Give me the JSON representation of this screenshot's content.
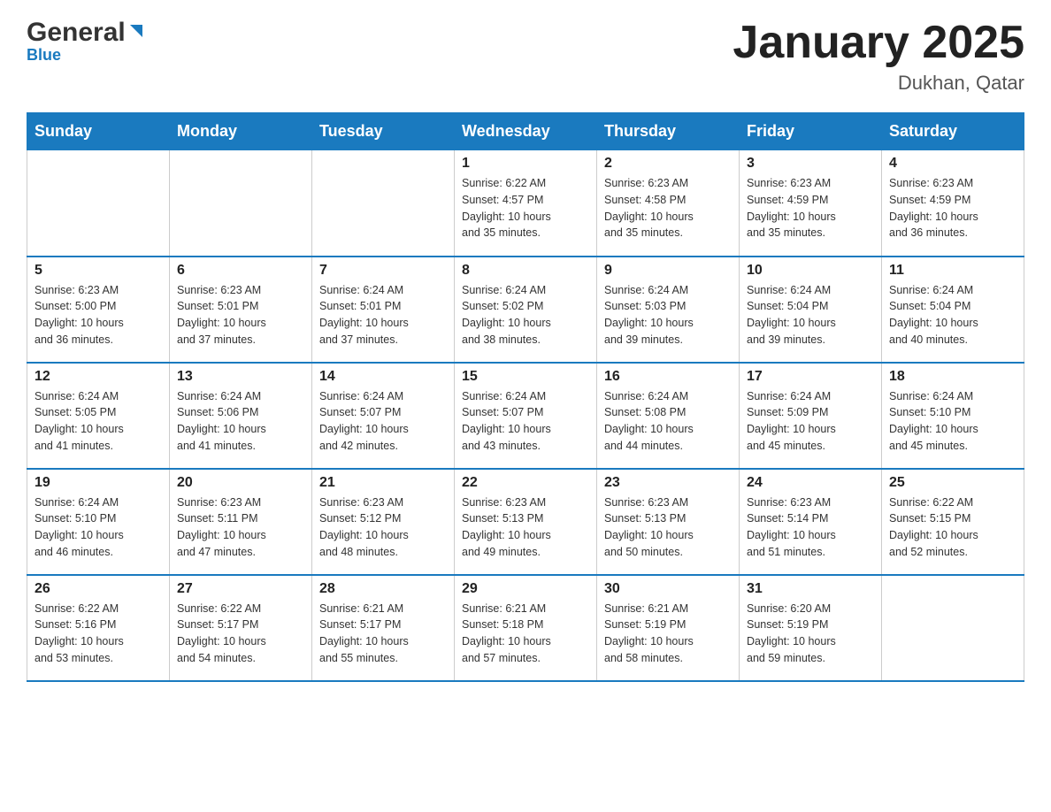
{
  "header": {
    "logo_general": "General",
    "logo_blue": "Blue",
    "month_title": "January 2025",
    "location": "Dukhan, Qatar"
  },
  "days_of_week": [
    "Sunday",
    "Monday",
    "Tuesday",
    "Wednesday",
    "Thursday",
    "Friday",
    "Saturday"
  ],
  "weeks": [
    [
      {
        "day": "",
        "info": ""
      },
      {
        "day": "",
        "info": ""
      },
      {
        "day": "",
        "info": ""
      },
      {
        "day": "1",
        "info": "Sunrise: 6:22 AM\nSunset: 4:57 PM\nDaylight: 10 hours\nand 35 minutes."
      },
      {
        "day": "2",
        "info": "Sunrise: 6:23 AM\nSunset: 4:58 PM\nDaylight: 10 hours\nand 35 minutes."
      },
      {
        "day": "3",
        "info": "Sunrise: 6:23 AM\nSunset: 4:59 PM\nDaylight: 10 hours\nand 35 minutes."
      },
      {
        "day": "4",
        "info": "Sunrise: 6:23 AM\nSunset: 4:59 PM\nDaylight: 10 hours\nand 36 minutes."
      }
    ],
    [
      {
        "day": "5",
        "info": "Sunrise: 6:23 AM\nSunset: 5:00 PM\nDaylight: 10 hours\nand 36 minutes."
      },
      {
        "day": "6",
        "info": "Sunrise: 6:23 AM\nSunset: 5:01 PM\nDaylight: 10 hours\nand 37 minutes."
      },
      {
        "day": "7",
        "info": "Sunrise: 6:24 AM\nSunset: 5:01 PM\nDaylight: 10 hours\nand 37 minutes."
      },
      {
        "day": "8",
        "info": "Sunrise: 6:24 AM\nSunset: 5:02 PM\nDaylight: 10 hours\nand 38 minutes."
      },
      {
        "day": "9",
        "info": "Sunrise: 6:24 AM\nSunset: 5:03 PM\nDaylight: 10 hours\nand 39 minutes."
      },
      {
        "day": "10",
        "info": "Sunrise: 6:24 AM\nSunset: 5:04 PM\nDaylight: 10 hours\nand 39 minutes."
      },
      {
        "day": "11",
        "info": "Sunrise: 6:24 AM\nSunset: 5:04 PM\nDaylight: 10 hours\nand 40 minutes."
      }
    ],
    [
      {
        "day": "12",
        "info": "Sunrise: 6:24 AM\nSunset: 5:05 PM\nDaylight: 10 hours\nand 41 minutes."
      },
      {
        "day": "13",
        "info": "Sunrise: 6:24 AM\nSunset: 5:06 PM\nDaylight: 10 hours\nand 41 minutes."
      },
      {
        "day": "14",
        "info": "Sunrise: 6:24 AM\nSunset: 5:07 PM\nDaylight: 10 hours\nand 42 minutes."
      },
      {
        "day": "15",
        "info": "Sunrise: 6:24 AM\nSunset: 5:07 PM\nDaylight: 10 hours\nand 43 minutes."
      },
      {
        "day": "16",
        "info": "Sunrise: 6:24 AM\nSunset: 5:08 PM\nDaylight: 10 hours\nand 44 minutes."
      },
      {
        "day": "17",
        "info": "Sunrise: 6:24 AM\nSunset: 5:09 PM\nDaylight: 10 hours\nand 45 minutes."
      },
      {
        "day": "18",
        "info": "Sunrise: 6:24 AM\nSunset: 5:10 PM\nDaylight: 10 hours\nand 45 minutes."
      }
    ],
    [
      {
        "day": "19",
        "info": "Sunrise: 6:24 AM\nSunset: 5:10 PM\nDaylight: 10 hours\nand 46 minutes."
      },
      {
        "day": "20",
        "info": "Sunrise: 6:23 AM\nSunset: 5:11 PM\nDaylight: 10 hours\nand 47 minutes."
      },
      {
        "day": "21",
        "info": "Sunrise: 6:23 AM\nSunset: 5:12 PM\nDaylight: 10 hours\nand 48 minutes."
      },
      {
        "day": "22",
        "info": "Sunrise: 6:23 AM\nSunset: 5:13 PM\nDaylight: 10 hours\nand 49 minutes."
      },
      {
        "day": "23",
        "info": "Sunrise: 6:23 AM\nSunset: 5:13 PM\nDaylight: 10 hours\nand 50 minutes."
      },
      {
        "day": "24",
        "info": "Sunrise: 6:23 AM\nSunset: 5:14 PM\nDaylight: 10 hours\nand 51 minutes."
      },
      {
        "day": "25",
        "info": "Sunrise: 6:22 AM\nSunset: 5:15 PM\nDaylight: 10 hours\nand 52 minutes."
      }
    ],
    [
      {
        "day": "26",
        "info": "Sunrise: 6:22 AM\nSunset: 5:16 PM\nDaylight: 10 hours\nand 53 minutes."
      },
      {
        "day": "27",
        "info": "Sunrise: 6:22 AM\nSunset: 5:17 PM\nDaylight: 10 hours\nand 54 minutes."
      },
      {
        "day": "28",
        "info": "Sunrise: 6:21 AM\nSunset: 5:17 PM\nDaylight: 10 hours\nand 55 minutes."
      },
      {
        "day": "29",
        "info": "Sunrise: 6:21 AM\nSunset: 5:18 PM\nDaylight: 10 hours\nand 57 minutes."
      },
      {
        "day": "30",
        "info": "Sunrise: 6:21 AM\nSunset: 5:19 PM\nDaylight: 10 hours\nand 58 minutes."
      },
      {
        "day": "31",
        "info": "Sunrise: 6:20 AM\nSunset: 5:19 PM\nDaylight: 10 hours\nand 59 minutes."
      },
      {
        "day": "",
        "info": ""
      }
    ]
  ]
}
